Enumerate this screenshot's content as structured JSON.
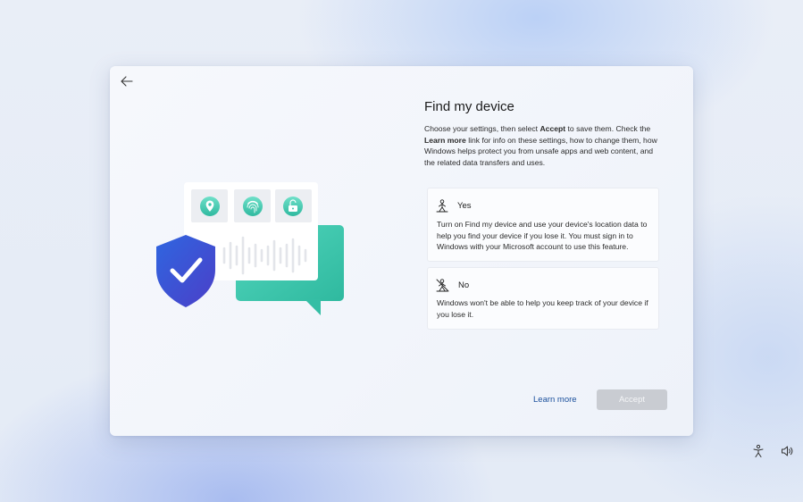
{
  "dialog": {
    "title": "Find my device",
    "description_parts": {
      "p1": "Choose your settings, then select ",
      "b1": "Accept",
      "p2": " to save them. Check the ",
      "b2": "Learn more",
      "p3": " link for info on these settings, how to change them, how Windows helps protect you from unsafe apps and web content, and the related data transfers and uses."
    },
    "options": [
      {
        "label": "Yes",
        "icon": "person-location-icon",
        "description": "Turn on Find my device and use your device's location data to help you find your device if you lose it. You must sign in to Windows with your Microsoft account to use this feature."
      },
      {
        "label": "No",
        "icon": "person-location-off-icon",
        "description": "Windows won't be able to help you keep track of your device if you lose it."
      }
    ],
    "learn_more_label": "Learn more",
    "accept_label": "Accept"
  },
  "colors": {
    "accent_link": "#1a4f9c",
    "shield": "#3a4fd0",
    "teal": "#3cc6ae",
    "button_disabled": "#c9ccd2"
  },
  "tray": {
    "icons": [
      "accessibility-icon",
      "volume-icon"
    ]
  }
}
